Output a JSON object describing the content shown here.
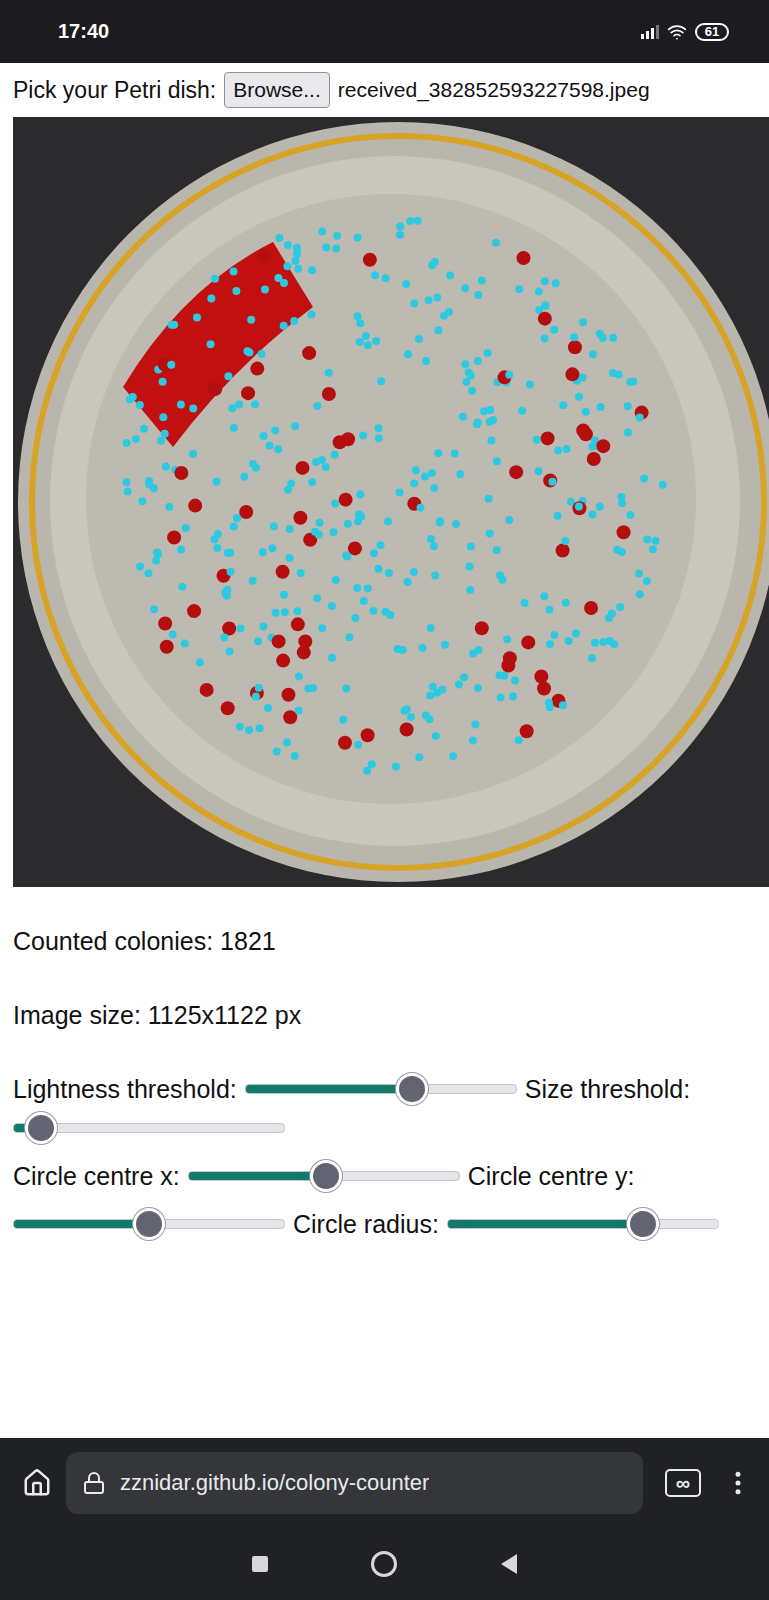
{
  "status_bar": {
    "time": "17:40",
    "battery": "61"
  },
  "file_picker": {
    "label": "Pick your Petri dish:",
    "button": "Browse...",
    "filename": "received_382852593227598.jpeg"
  },
  "results": [
    "Counted colonies: 1821",
    "Image size: 1125x1122 px"
  ],
  "slider_groups": [
    [
      {
        "label": "Lightness threshold:",
        "level": 0.63
      },
      {
        "label": "Size threshold:",
        "level": 0.05
      }
    ],
    [
      {
        "label": "Circle centre x:",
        "level": 0.51
      },
      {
        "label": "Circle centre y:",
        "level": 0.5
      },
      {
        "label": "Circle radius:",
        "level": 0.75
      }
    ]
  ],
  "browser": {
    "url": "zznidar.github.io/colony-counter",
    "tabs_icon": "∞"
  }
}
